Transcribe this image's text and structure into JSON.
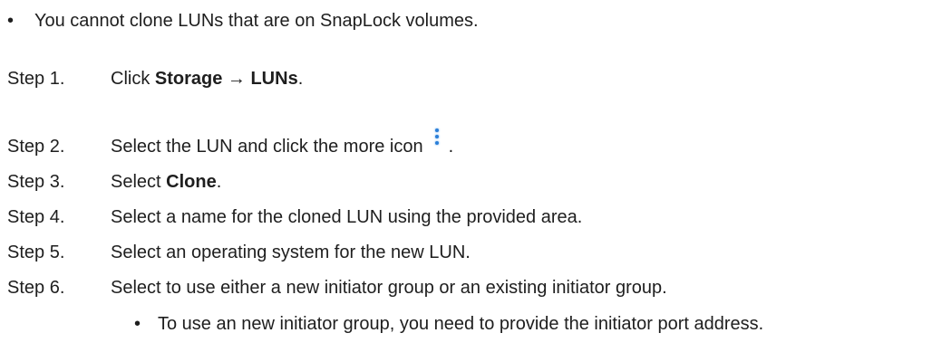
{
  "intro_bullet": {
    "bullet": "•",
    "text": "You cannot clone LUNs that are on SnapLock volumes."
  },
  "steps": [
    {
      "label": "Step 1.",
      "pre": "Click ",
      "bold": "Storage → LUNs",
      "post": "."
    },
    {
      "label": "Step 2.",
      "pre": "Select the LUN and click the more icon",
      "post": "."
    },
    {
      "label": "Step 3.",
      "pre": "Select ",
      "bold": "Clone",
      "post": "."
    },
    {
      "label": "Step 4.",
      "text": "Select a name for the cloned LUN using the provided area."
    },
    {
      "label": "Step 5.",
      "text": "Select an operating system for the new LUN."
    },
    {
      "label": "Step 6.",
      "text": "Select to use either a new initiator group or an existing initiator group."
    }
  ],
  "sub_bullet": {
    "bullet": "•",
    "text": "To use an new initiator group, you need to provide the initiator port address."
  },
  "icons": {
    "more": "more-vertical-icon"
  },
  "colors": {
    "text": "#1e1e1e",
    "icon": "#2b7fd8"
  }
}
